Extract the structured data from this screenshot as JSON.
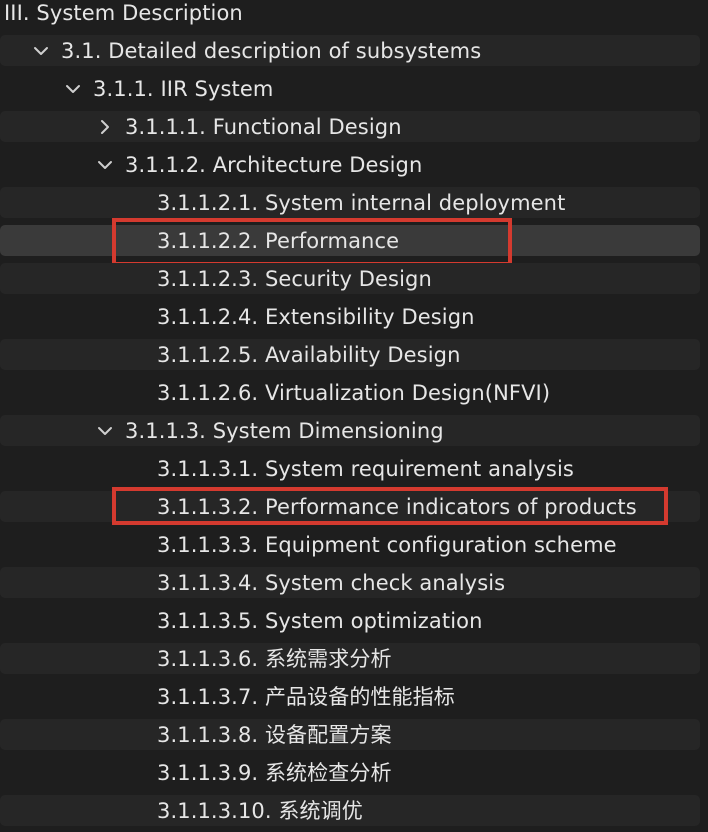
{
  "tree": {
    "nodes": [
      {
        "label": "III. System Description",
        "chevron": "expanded"
      },
      {
        "label": "3.1. Detailed description of subsystems",
        "chevron": "expanded"
      },
      {
        "label": "3.1.1. IIR System",
        "chevron": "expanded"
      },
      {
        "label": "3.1.1.1. Functional Design",
        "chevron": "collapsed"
      },
      {
        "label": "3.1.1.2. Architecture Design",
        "chevron": "expanded"
      },
      {
        "label": "3.1.1.2.1. System internal deployment",
        "chevron": "none"
      },
      {
        "label": "3.1.1.2.2. Performance",
        "chevron": "none",
        "selected": true,
        "highlighted": true
      },
      {
        "label": "3.1.1.2.3. Security Design",
        "chevron": "none"
      },
      {
        "label": "3.1.1.2.4. Extensibility Design",
        "chevron": "none"
      },
      {
        "label": "3.1.1.2.5. Availability Design",
        "chevron": "none"
      },
      {
        "label": "3.1.1.2.6. Virtualization Design(NFVI)",
        "chevron": "none"
      },
      {
        "label": "3.1.1.3. System Dimensioning",
        "chevron": "expanded"
      },
      {
        "label": "3.1.1.3.1. System requirement analysis",
        "chevron": "none"
      },
      {
        "label": "3.1.1.3.2. Performance indicators of products",
        "chevron": "none",
        "highlighted": true
      },
      {
        "label": "3.1.1.3.3. Equipment configuration scheme",
        "chevron": "none"
      },
      {
        "label": "3.1.1.3.4. System check analysis",
        "chevron": "none"
      },
      {
        "label": "3.1.1.3.5. System optimization",
        "chevron": "none"
      },
      {
        "label": "3.1.1.3.6. 系统需求分析",
        "chevron": "none"
      },
      {
        "label": "3.1.1.3.7. 产品设备的性能指标",
        "chevron": "none"
      },
      {
        "label": "3.1.1.3.8. 设备配置方案",
        "chevron": "none"
      },
      {
        "label": "3.1.1.3.9. 系统检查分析",
        "chevron": "none"
      },
      {
        "label": "3.1.1.3.10. 系统调优",
        "chevron": "none"
      }
    ]
  },
  "colors": {
    "background": "#1e1e1e",
    "row_stripe": "#262626",
    "selected_row": "#3a3a3a",
    "text": "#e6e6e6",
    "highlight_box": "#d43a2f"
  }
}
